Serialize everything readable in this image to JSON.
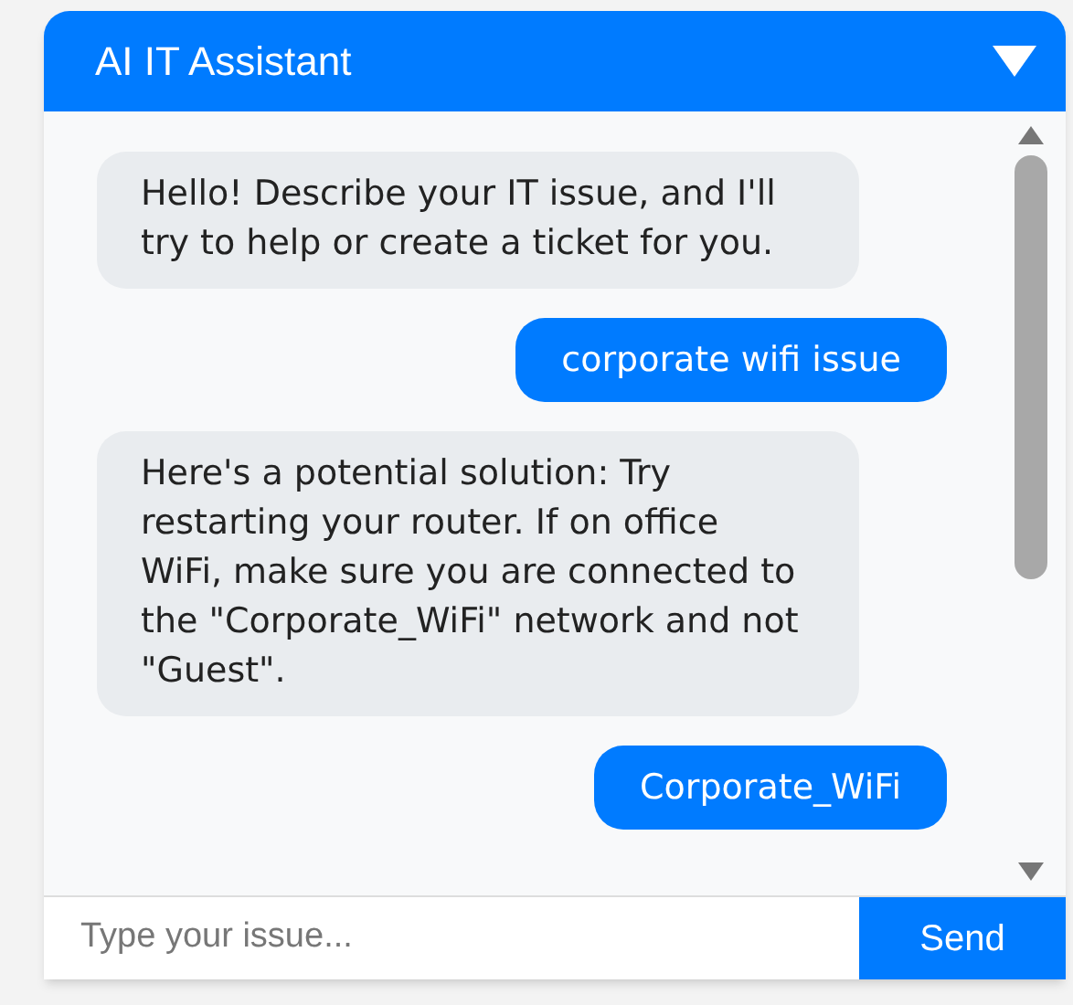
{
  "chat": {
    "title": "AI IT Assistant",
    "messages": [
      {
        "kind": "bot",
        "text": "Hello! Describe your IT issue, and I'll try to help or create a ticket for you."
      },
      {
        "kind": "user",
        "text": "corporate wifi issue"
      },
      {
        "kind": "bot",
        "text": "Here's a potential solution: Try restarting your router. If on office WiFi, make sure you are connected to the \"Corporate_WiFi\" network and not \"Guest\"."
      },
      {
        "kind": "user",
        "text": "Corporate_WiFi"
      }
    ],
    "input": {
      "placeholder": "Type your issue..."
    },
    "send_button": "Send"
  }
}
